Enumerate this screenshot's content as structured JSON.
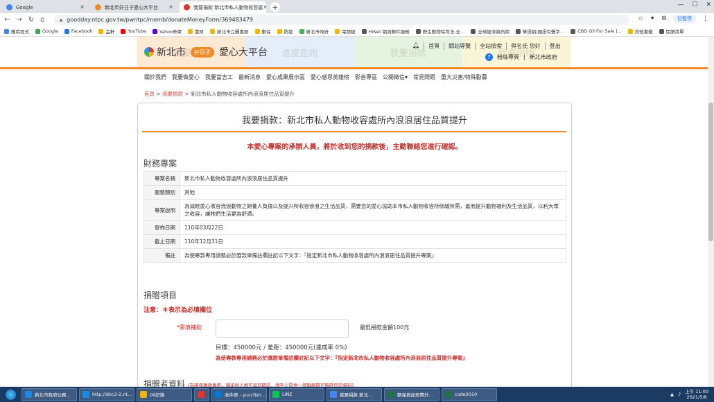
{
  "browser": {
    "tabs": [
      {
        "title": "Google",
        "active": false,
        "favicon_color": "#4285f4"
      },
      {
        "title": "新北市好日子愛心大平台",
        "active": false,
        "favicon_color": "#f08a24"
      },
      {
        "title": "我要捐款 新北市私人動物收容處",
        "active": true,
        "favicon_color": "#e6332a"
      }
    ],
    "url": "goodday.ntpc.gov.tw/pwntpc/memb/donateMoneyForm/369483479",
    "profile_label": "已暫停",
    "bookmarks": [
      {
        "label": "應用程式",
        "color": "#4285f4"
      },
      {
        "label": "Google",
        "color": "#34a853"
      },
      {
        "label": "Facebook",
        "color": "#1877f2"
      },
      {
        "label": "孟軒",
        "color": "#f4b400"
      },
      {
        "label": "YouTube",
        "color": "#ff0000"
      },
      {
        "label": "Yahoo奇摩",
        "color": "#6001d2"
      },
      {
        "label": "農財",
        "color": "#f4b400"
      },
      {
        "label": "新北市立圖書館",
        "color": "#f4b400"
      },
      {
        "label": "動保",
        "color": "#f4b400"
      },
      {
        "label": "防疫",
        "color": "#f4b400"
      },
      {
        "label": "新北市政府",
        "color": "#4caf50"
      },
      {
        "label": "電物經",
        "color": "#f4b400"
      },
      {
        "label": "HiNet 網頁郵件服務",
        "color": "#555555"
      },
      {
        "label": "野生動物保育法-全...",
        "color": "#555555"
      },
      {
        "label": "全球經濟資訊網",
        "color": "#555555"
      },
      {
        "label": "華語網/國語有聲字...",
        "color": "#555555"
      },
      {
        "label": "CBD Oil For Sale |...",
        "color": "#555555"
      },
      {
        "label": "其他書籤",
        "color": "#f4b400"
      },
      {
        "label": "閱讀清單",
        "color": "#555555"
      }
    ]
  },
  "site": {
    "logo_city": "新北市",
    "logo_badge": "好日子",
    "logo_title": "愛心大平台",
    "bg_tabs": [
      "我要捐款",
      "進度查詢",
      "我要捐物",
      "我要捐物"
    ],
    "top_links": [
      "首頁",
      "網站導覽",
      "全站檢索",
      "與名氏 您好",
      "登出"
    ],
    "fb_label": "粉絲專頁",
    "gov_label": "新北市政府",
    "nav": [
      "關於我們",
      "我要做愛心",
      "我要當志工",
      "最新消息",
      "愛心成果展示區",
      "愛心感恩英雄榜",
      "影音專區",
      "公開徵信▾",
      "常見問題",
      "重大災害/特殊勸募"
    ],
    "breadcrumb": {
      "home": "首頁",
      "sep1": " > ",
      "donate": "我要捐款",
      "sep2": " > ",
      "current": "新北市私人動物收容處所內浪浪居住品質提升"
    }
  },
  "page": {
    "title": "我要捐款：新北市私人動物收容處所內浪浪居住品質提升",
    "notice": "本愛心專案的承辦人員，將於收到您的捐款後，主動聯絡您進行確認。",
    "finance_heading": "財務專案",
    "table": [
      {
        "k": "專案名稱",
        "v": "新北市私人動物收容處所內浪浪居住品質提升"
      },
      {
        "k": "服務類別",
        "v": "其他"
      },
      {
        "k": "專案說明",
        "v": "為減輕愛心收容流浪動物之飼養人負擔以及提升所收容浪浪之生活品質，需要您的愛心協助本市私人動物收容所修繕所需，進而提升動物福利及生活品質，以利大眾之收容，讓牠們生活更為舒適。"
      },
      {
        "k": "發佈日期",
        "v": "110年03月22日"
      },
      {
        "k": "截止日期",
        "v": "110年12月31日"
      },
      {
        "k": "備註",
        "v": "為使專款專用請務必於匯款單備註欄註記以下文字：『指定新北市私人動物收容處所內浪浪居住品質提升專案』"
      }
    ],
    "donate_heading": "捐贈項目",
    "required_note": "注意：＊表示為必填欄位",
    "field_label": "*需填補助",
    "field_value": "",
    "min_note": "最低捐款金額100元",
    "goal_text": "目標：450000元 / 差距：450000元(達成率 0%)",
    "goal_red": "為使專款專用請務必於匯款單備註欄註記以下文字：『指定新北市私人動物收容處所內浪浪居住品質提升專案』",
    "donor_heading": "捐贈者資料",
    "donor_note": "(為確保專款專用，讓承辦人員可與您確認，請至少提供一個聯絡時可稱呼您的資料)"
  },
  "taskbar": {
    "items": [
      {
        "label": "新北市政府公務...",
        "color": "#1e88e5"
      },
      {
        "label": "http://doc2-2.nt...",
        "color": "#1e88e5"
      },
      {
        "label": "09記錄",
        "color": "#f4b400"
      },
      {
        "label": "",
        "color": "#e6332a"
      },
      {
        "label": "收件匣 - yuccfish...",
        "color": "#0078d4"
      },
      {
        "label": "LINE",
        "color": "#06c755"
      },
      {
        "label": "我要捐款 新北...",
        "color": "#4285f4"
      },
      {
        "label": "動保員加班費計...",
        "color": "#217346"
      },
      {
        "label": "code2020",
        "color": "#217346"
      }
    ],
    "time": "上午 11:00",
    "date": "2021/5/6"
  }
}
